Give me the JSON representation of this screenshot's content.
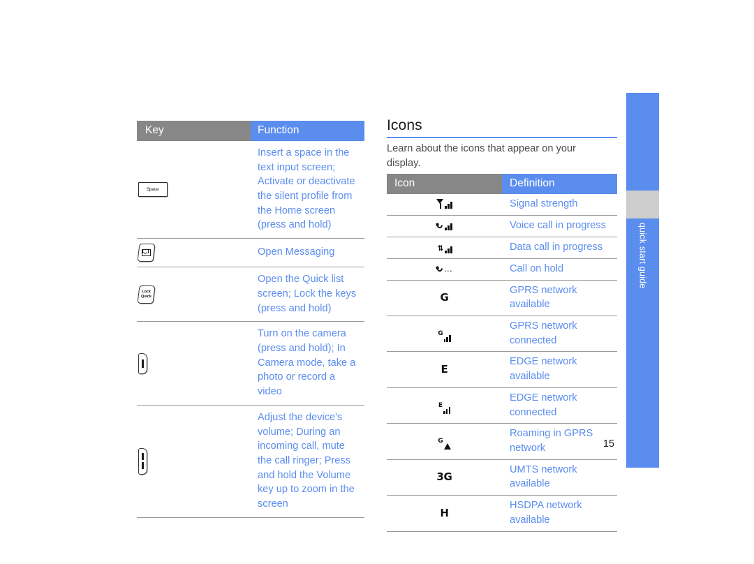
{
  "page": {
    "number": "15"
  },
  "side_tab": {
    "label": "quick start guide",
    "color": "#5b8def",
    "gap_color": "#cecece"
  },
  "key_table": {
    "header": {
      "key": "Key",
      "function": "Function"
    },
    "header_key_color": "#878787",
    "header_function_color": "#5b8def",
    "rows": [
      {
        "icon": "space-key-icon",
        "icon_label": "Space",
        "function": "Insert a space in the text input screen; Activate or deactivate the silent profile from the Home screen (press and hold)"
      },
      {
        "icon": "messaging-key-icon",
        "icon_label": "",
        "function": "Open Messaging"
      },
      {
        "icon": "lock-quick-key-icon",
        "icon_label": "Lock Quick",
        "icon_label_line1": "Lock",
        "icon_label_line2": "Quick",
        "function": "Open the Quick list screen; Lock the keys (press and hold)"
      },
      {
        "icon": "camera-key-icon",
        "icon_label": "",
        "function": "Turn on the camera (press and hold); In Camera mode, take a photo or record a video"
      },
      {
        "icon": "volume-key-icon",
        "icon_label": "",
        "function": "Adjust the device's volume; During an incoming call, mute the call ringer; Press and hold the Volume key up to zoom in the screen"
      }
    ]
  },
  "icons_section": {
    "title": "Icons",
    "body": "Learn about the icons that appear on your display.",
    "table": {
      "header": {
        "icon": "Icon",
        "definition": "Definition"
      },
      "rows": [
        {
          "icon": "signal-strength-icon",
          "definition": "Signal strength"
        },
        {
          "icon": "voice-call-icon",
          "definition": "Voice call in progress"
        },
        {
          "icon": "data-call-icon",
          "definition": "Data call in progress"
        },
        {
          "icon": "call-on-hold-icon",
          "definition": "Call on hold"
        },
        {
          "icon": "gprs-available-icon",
          "letter": "G",
          "definition": "GPRS network available"
        },
        {
          "icon": "gprs-connected-icon",
          "letter": "G",
          "definition": "GPRS network connected"
        },
        {
          "icon": "edge-available-icon",
          "letter": "E",
          "definition": "EDGE network available"
        },
        {
          "icon": "edge-connected-icon",
          "letter": "E",
          "definition": "EDGE network connected"
        },
        {
          "icon": "gprs-roaming-icon",
          "letter": "G",
          "definition": "Roaming in GPRS network"
        },
        {
          "icon": "umts-available-icon",
          "letter": "3G",
          "definition": "UMTS network available"
        },
        {
          "icon": "hsdpa-available-icon",
          "letter": "H",
          "definition": "HSDPA network available"
        }
      ]
    }
  }
}
